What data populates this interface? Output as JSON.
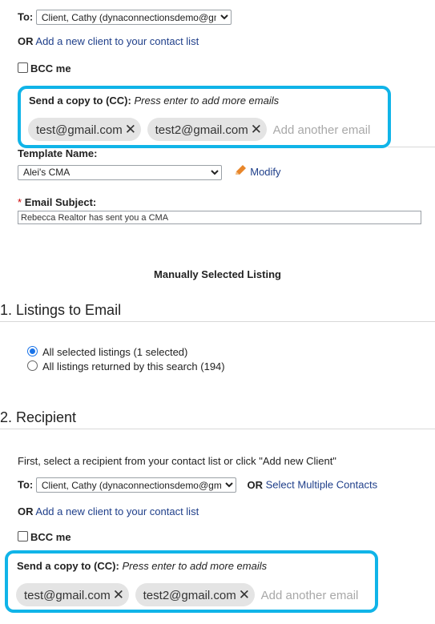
{
  "top": {
    "to_label": "To:",
    "to_selected": "Client, Cathy (dynaconnectionsdemo@gmail.",
    "or_label": "OR",
    "add_client_link": "Add a new client to your contact list",
    "bcc_label": "BCC me",
    "cc": {
      "title": "Send a copy to (CC):",
      "hint": "Press enter to add more emails",
      "chips": [
        "test@gmail.com",
        "test2@gmail.com"
      ],
      "add_placeholder": "Add another email"
    }
  },
  "template": {
    "label": "Template Name:",
    "selected": "Alei's CMA",
    "modify_label": "Modify"
  },
  "subject": {
    "required_mark": "*",
    "label": "Email Subject:",
    "value": "Rebecca Realtor has sent you a CMA"
  },
  "manual_heading": "Manually Selected Listing",
  "listings": {
    "heading": "1. Listings to Email",
    "options": [
      {
        "label": "All selected listings (1 selected)",
        "selected": true
      },
      {
        "label": "All listings returned by this search (194)",
        "selected": false
      }
    ]
  },
  "recipient": {
    "heading": "2. Recipient",
    "instruction": "First, select a recipient from your contact list or click \"Add new Client\"",
    "to_label": "To:",
    "to_selected": "Client, Cathy (dynaconnectionsdemo@gmail.",
    "or_label": "OR",
    "select_multiple_link": "Select Multiple Contacts",
    "add_client_link": "Add a new client to your contact list",
    "bcc_label": "BCC me",
    "cc": {
      "title": "Send a copy to (CC):",
      "hint": "Press enter to add more emails",
      "chips": [
        "test@gmail.com",
        "test2@gmail.com"
      ],
      "add_placeholder": "Add another email"
    }
  },
  "colors": {
    "highlight": "#10b4e8",
    "link": "#1f3f8a",
    "required": "#cc0000",
    "radio": "#1a73e8",
    "pencil": "#e8862a"
  }
}
